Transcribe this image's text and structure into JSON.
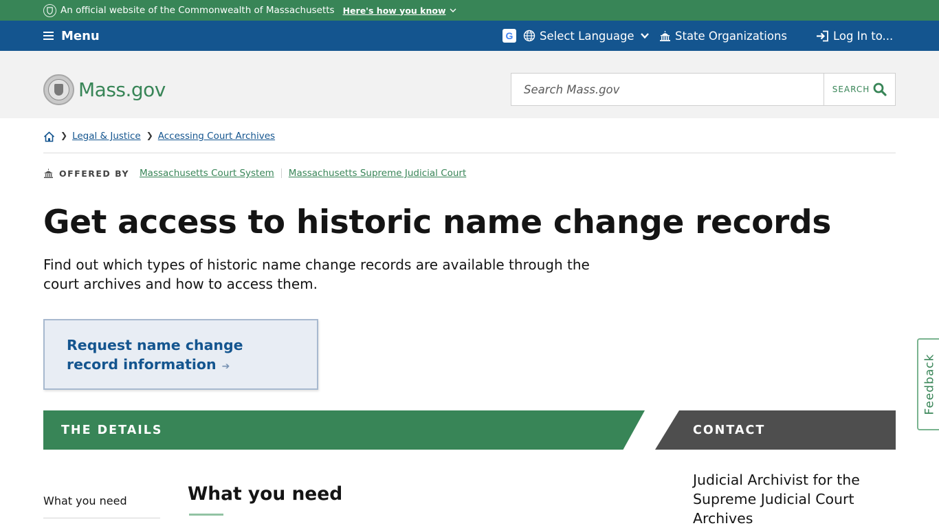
{
  "official_banner": {
    "text": "An official website of the Commonwealth of Massachusetts",
    "how_link": "Here's how you know",
    "icon": "seal-icon"
  },
  "util_nav": {
    "menu_label": "Menu",
    "language_label": "Select Language",
    "orgs_label": "State Organizations",
    "login_label": "Log In to..."
  },
  "header": {
    "logo_text": "Mass.gov",
    "search_placeholder": "Search Mass.gov",
    "search_button": "SEARCH"
  },
  "breadcrumb": {
    "items": [
      "Legal & Justice",
      "Accessing Court Archives"
    ]
  },
  "offered_by": {
    "label": "OFFERED BY",
    "orgs": [
      "Massachusetts Court System",
      "Massachusetts Supreme Judicial Court"
    ]
  },
  "page": {
    "title": "Get access to historic name change records",
    "lede": "Find out which types of historic name change records are available through the court archives and how to access them.",
    "cta_label": "Request name change record information"
  },
  "sections": {
    "details_label": "THE DETAILS",
    "contact_label": "CONTACT",
    "toc_item": "What you need",
    "heading": "What you need",
    "contact_name": "Judicial Archivist for the Supreme Judicial Court Archives"
  },
  "feedback_label": "Feedback",
  "colors": {
    "green": "#388557",
    "blue": "#14558f",
    "gray_bar": "#4e4e4e"
  }
}
